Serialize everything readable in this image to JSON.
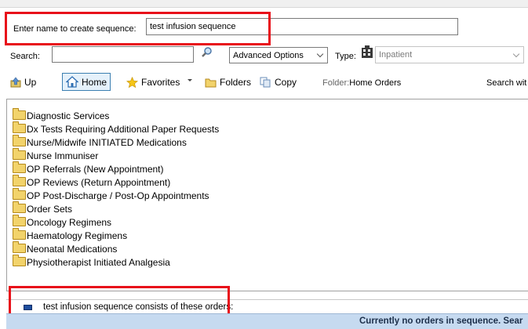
{
  "sequence": {
    "name_label": "Enter name to create sequence:",
    "name_value": "test infusion sequence"
  },
  "search": {
    "label": "Search:",
    "value": "",
    "advanced_options": "Advanced Options",
    "type_label": "Type:",
    "type_value": "Inpatient"
  },
  "toolbar": {
    "up": "Up",
    "home": "Home",
    "favorites": "Favorites",
    "folders": "Folders",
    "copy": "Copy",
    "folder_label": "Folder:",
    "folder_value": "Home Orders",
    "search_within": "Search wit"
  },
  "folders": [
    "Diagnostic Services",
    "Dx Tests Requiring Additional Paper Requests",
    "Nurse/Midwife INITIATED Medications",
    "Nurse Immuniser",
    "OP Referrals (New Appointment)",
    "OP Reviews (Return Appointment)",
    "OP Post-Discharge / Post-Op Appointments",
    "Order Sets",
    "Oncology Regimens",
    "Haematology Regimens",
    "Neonatal Medications",
    "Physiotherapist Initiated Analgesia"
  ],
  "sequence_orders": {
    "label": "test infusion sequence consists of these orders:",
    "status": "Currently no orders in sequence. Sear"
  },
  "colors": {
    "highlight": "#e8101a",
    "status_bar": "#c6daf0"
  },
  "icons": {
    "search": "magnifier-icon",
    "type": "patient-type-icon",
    "up": "up-arrow-icon",
    "home": "home-icon",
    "favorites": "star-icon",
    "folders": "folder-icon",
    "copy": "copy-icon"
  }
}
